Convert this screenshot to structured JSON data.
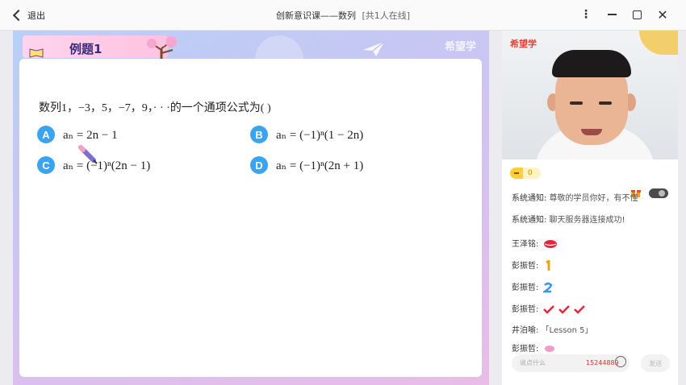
{
  "window": {
    "back_label": "退出",
    "title": "创新意识课——数列",
    "online": "[共1人在线]",
    "more_glyph": "⋮",
    "close_glyph": "✕"
  },
  "slide": {
    "tag": "例题1",
    "watermark": "希望学",
    "question": "数列1，−3，5，−7，9，· · ·的一个通项公式为(      )",
    "options": [
      {
        "letter": "A",
        "formula": "aₙ = 2n − 1"
      },
      {
        "letter": "B",
        "formula": "aₙ = (−1)ⁿ(1 − 2n)"
      },
      {
        "letter": "C",
        "formula": "aₙ = (−1)ⁿ(2n − 1)"
      },
      {
        "letter": "D",
        "formula": "aₙ = (−1)ⁿ(2n + 1)"
      }
    ]
  },
  "video": {
    "brand": "希望学"
  },
  "chat": {
    "coins": "0",
    "messages": [
      {
        "who": "系统通知:",
        "text": " 尊敬的学员你好，有不懂"
      },
      {
        "who": "系统通知:",
        "text": " 聊天服务器连接成功!"
      },
      {
        "who": "王泽铭:",
        "text": ""
      },
      {
        "who": "彭振哲:",
        "text": ""
      },
      {
        "who": "彭振哲:",
        "text": ""
      },
      {
        "who": "彭振哲:",
        "text": ""
      },
      {
        "who": "井泊喻:",
        "text": " 「Lesson 5」"
      },
      {
        "who": "彭振哲:",
        "text": ""
      }
    ],
    "input_placeholder": "说点什么",
    "input_typed": "15244889",
    "send_label": "发送"
  },
  "colors": {
    "option_badge": "#3aa4f0",
    "accent_red": "#e6402f"
  }
}
